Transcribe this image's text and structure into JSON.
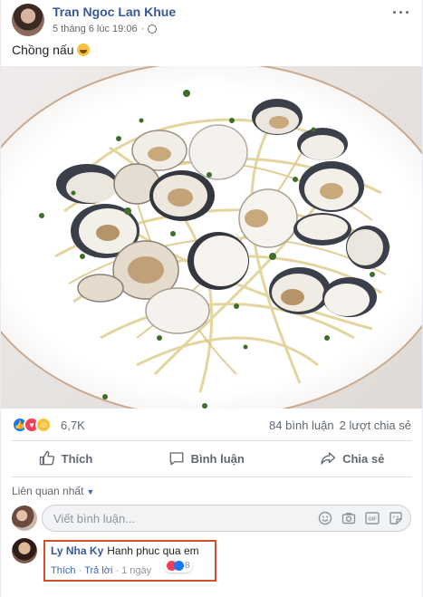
{
  "post": {
    "author": "Tran Ngoc Lan Khue",
    "timestamp": "5 tháng 6 lúc 19:06",
    "privacy_icon": "globe-icon",
    "text": "Chồng nấu",
    "more_label": "···"
  },
  "stats": {
    "reactions_count": "6,7K",
    "comments": "84 bình luận",
    "shares": "2 lượt chia sẻ",
    "reaction_types": [
      "like",
      "love",
      "haha"
    ]
  },
  "actions": {
    "like": "Thích",
    "comment": "Bình luận",
    "share": "Chia sẻ"
  },
  "comments_section": {
    "sort_label": "Liên quan nhất",
    "composer_placeholder": "Viết bình luận...",
    "composer_tools": [
      "emoji-icon",
      "camera-icon",
      "gif-icon",
      "sticker-icon"
    ],
    "gif_label": "GIF",
    "comments": [
      {
        "name": "Ly Nha Ky",
        "text": "Hanh phuc qua em",
        "like_action": "Thích",
        "reply_action": "Trả lời",
        "age": "1 ngày",
        "reaction_count": "8"
      }
    ]
  },
  "colors": {
    "link_blue": "#385898",
    "highlight_border": "#d4502a",
    "like_blue": "#1877f2",
    "love_red": "#f33e58"
  }
}
